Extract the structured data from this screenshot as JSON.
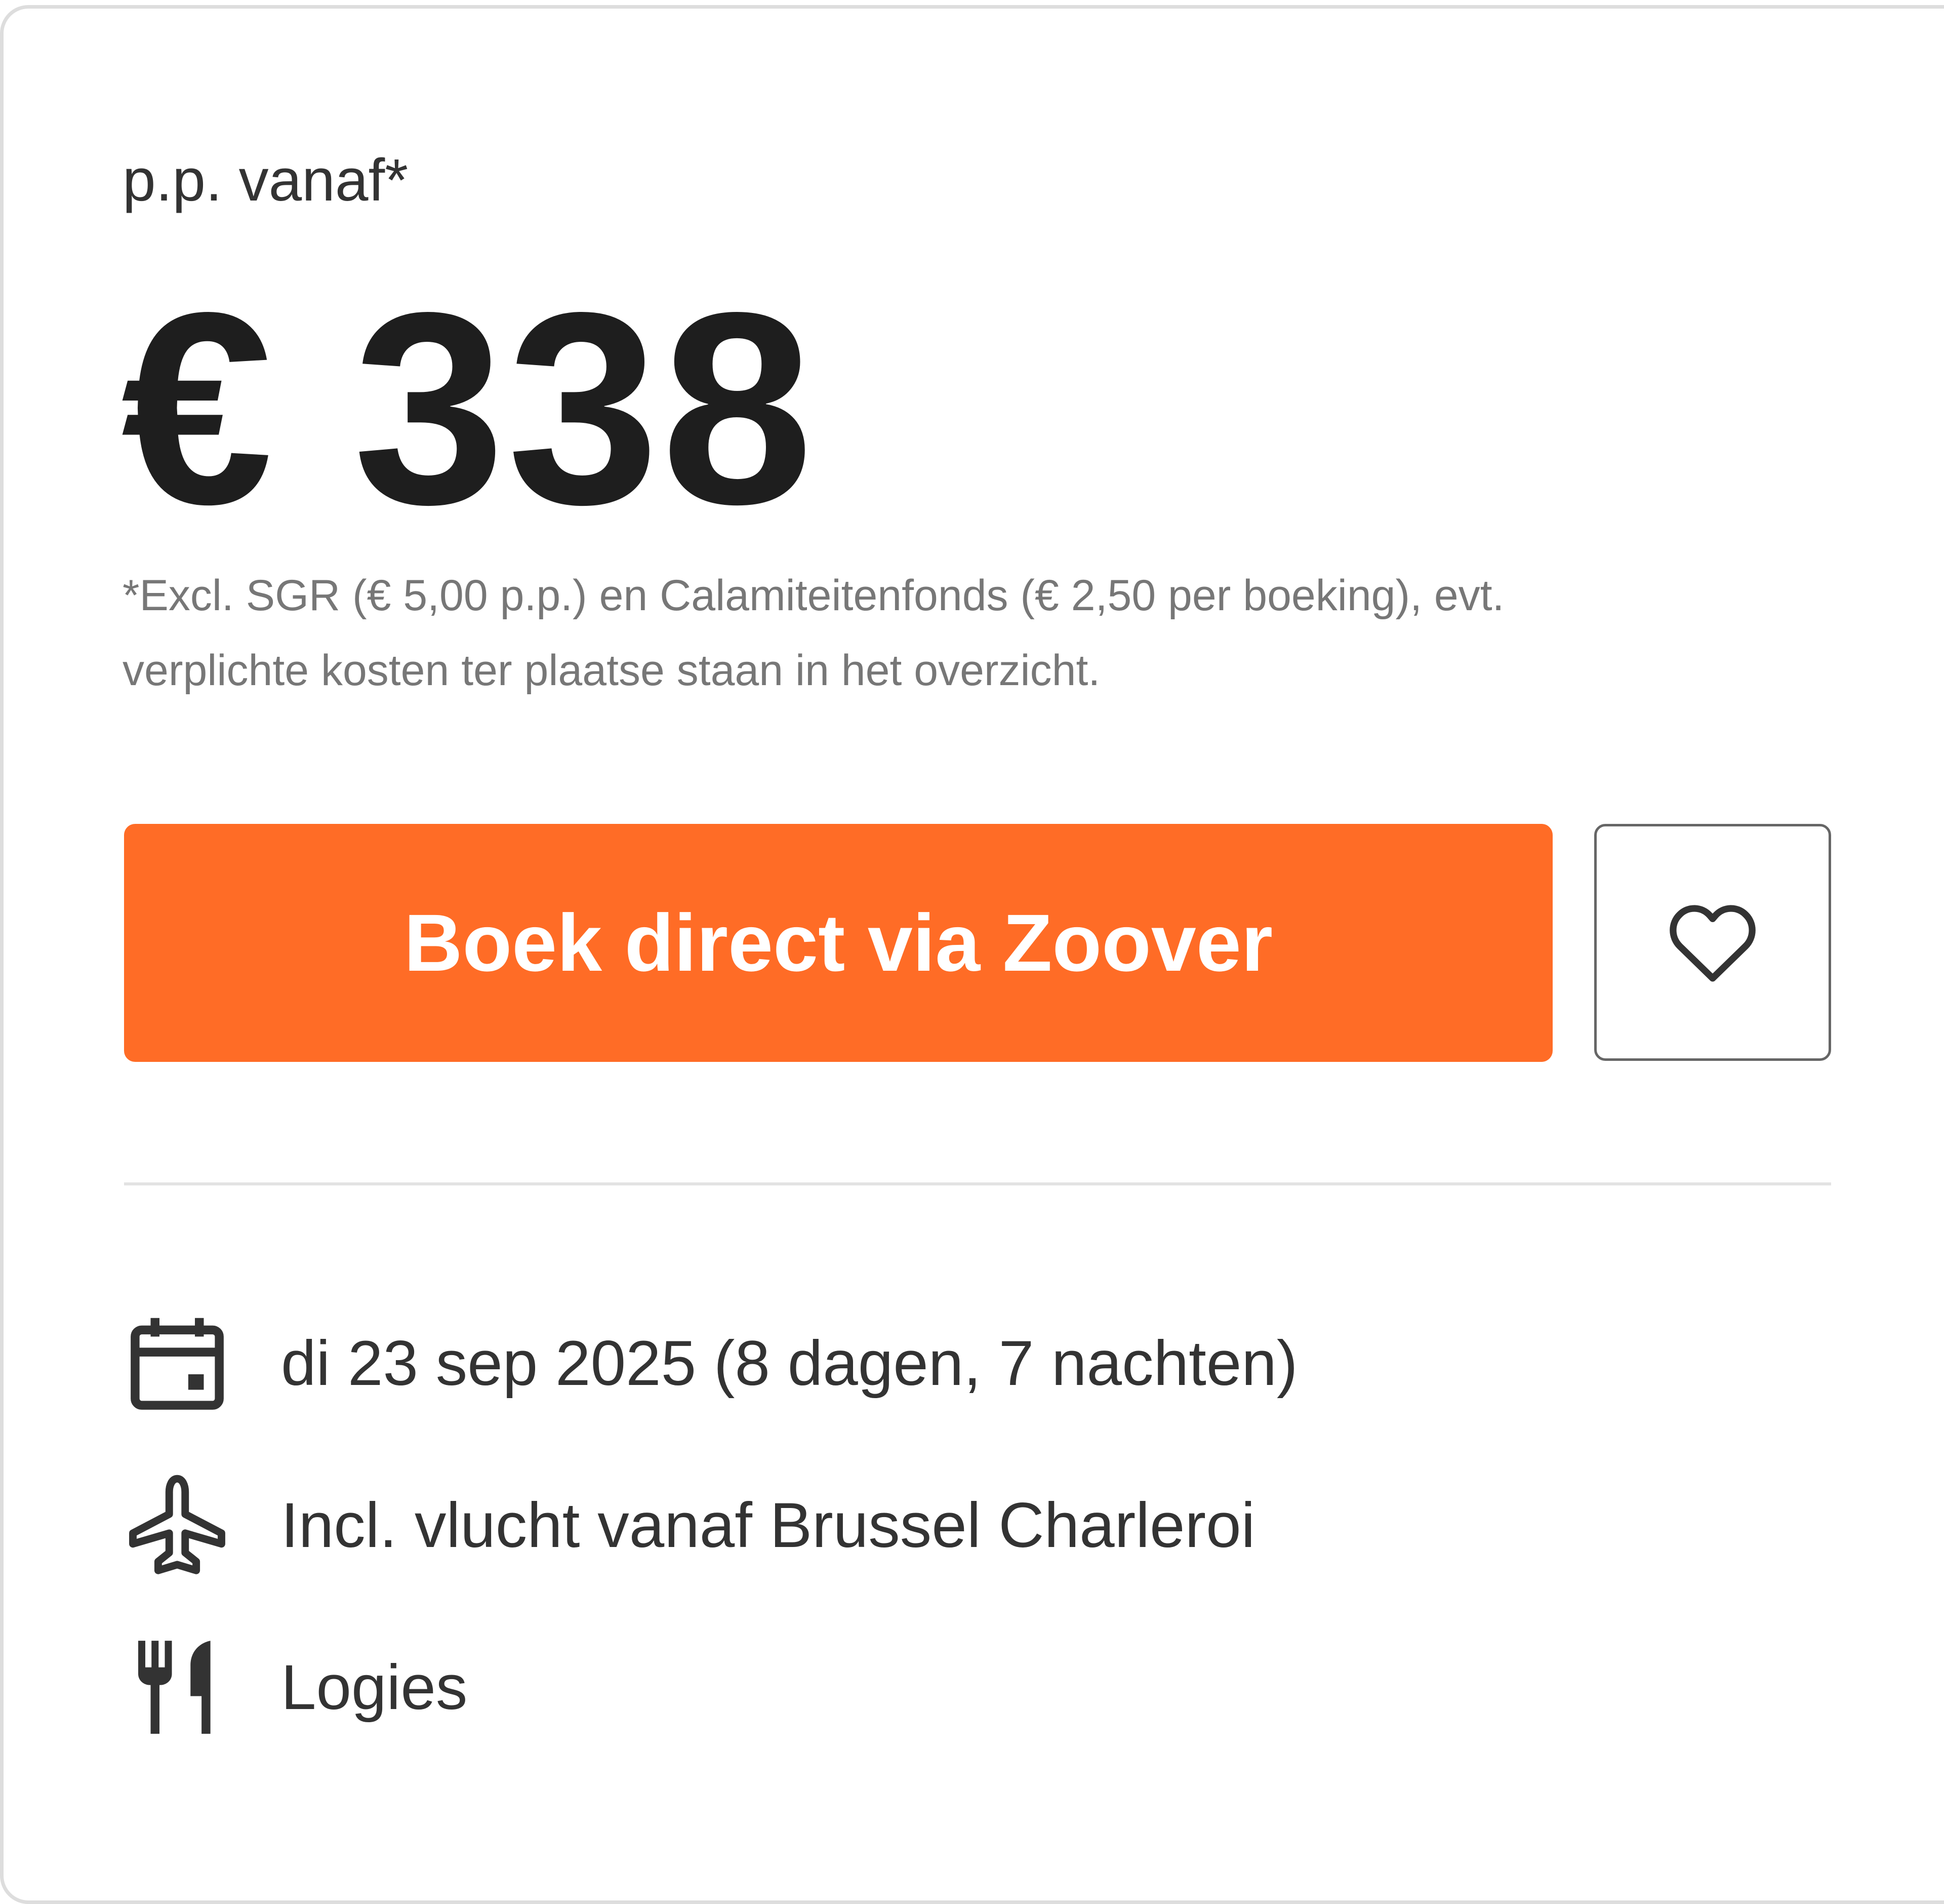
{
  "offer": {
    "pp_label": "p.p. vanaf*",
    "price": "€ 338",
    "disclaimer_line1": "*Excl. SGR (€ 5,00 p.p.) en Calamiteitenfonds (€ 2,50 per boeking), evt.",
    "disclaimer_line2": "verplichte kosten ter plaatse staan in het overzicht.",
    "book_button_label": "Boek direct via Zoover",
    "favorite_icon": "heart-icon",
    "accent_color": "#ff6c26"
  },
  "details": [
    {
      "icon": "calendar-icon",
      "text": "di 23 sep 2025 (8 dagen, 7 nachten)"
    },
    {
      "icon": "plane-icon",
      "text": "Incl. vlucht vanaf Brussel Charleroi"
    },
    {
      "icon": "cutlery-icon",
      "text": "Logies"
    }
  ]
}
